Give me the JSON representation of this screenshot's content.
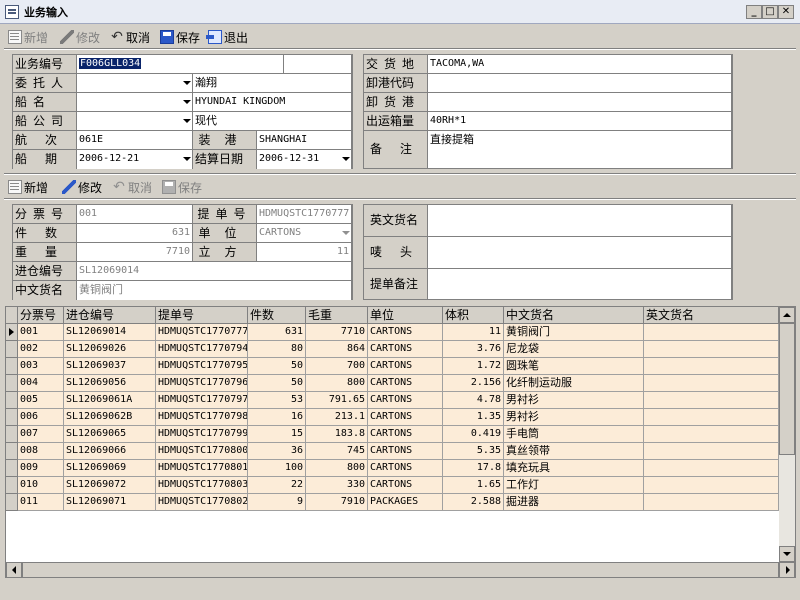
{
  "window": {
    "title": "业务输入"
  },
  "toolbar1": {
    "new": "新增",
    "edit": "修改",
    "cancel": "取消",
    "save": "保存",
    "exit": "退出"
  },
  "toolbar2": {
    "new": "新增",
    "edit": "修改",
    "cancel": "取消",
    "save": "保存"
  },
  "main_form": {
    "business_no_label": "业务编号",
    "business_no": "F006GLL034",
    "client_label": "委托人",
    "client": "",
    "client_name": "瀚翔",
    "ship_name_label": "船名",
    "ship_name": "",
    "ship_name_value": "HYUNDAI KINGDOM",
    "ship_company_label": "船公司",
    "ship_company": "",
    "ship_company_name": "现代",
    "voyage_label": "航次",
    "voyage": "061E",
    "load_port_label": "装港",
    "load_port": "SHANGHAI",
    "ship_date_label": "船期",
    "ship_date": "2006-12-21",
    "settle_date_label": "结算日期",
    "settle_date": "2006-12-31",
    "delivery_place_label": "交货地",
    "delivery_place": "TACOMA,WA",
    "unload_code_label": "卸港代码",
    "unload_code": "",
    "unload_port_label": "卸货港",
    "unload_port": "",
    "container_label": "出运箱量",
    "container": "40RH*1",
    "remark_label": "备注",
    "remark": "直接提箱"
  },
  "detail_form": {
    "split_no_label": "分票号",
    "split_no": "001",
    "bl_no_label": "提单号",
    "bl_no": "HDMUQSTC1770777",
    "pieces_label": "件数",
    "pieces": "631",
    "unit_label": "单位",
    "unit": "CARTONS",
    "weight_label": "重量",
    "weight": "7710",
    "volume_label": "立方",
    "volume": "11",
    "warehouse_no_label": "进仓编号",
    "warehouse_no": "SL12069014",
    "cn_goods_label": "中文货名",
    "cn_goods": "黄铜阀门",
    "en_goods_label": "英文货名",
    "en_goods": "",
    "mark_label": "唛头",
    "mark": "",
    "bl_remark_label": "提单备注",
    "bl_remark": ""
  },
  "grid": {
    "columns": [
      "分票号",
      "进仓编号",
      "提单号",
      "件数",
      "毛重",
      "单位",
      "体积",
      "中文货名",
      "英文货名"
    ],
    "rows": [
      [
        "001",
        "SL12069014",
        "HDMUQSTC1770777",
        "631",
        "7710",
        "CARTONS",
        "11",
        "黄铜阀门",
        ""
      ],
      [
        "002",
        "SL12069026",
        "HDMUQSTC1770794",
        "80",
        "864",
        "CARTONS",
        "3.76",
        "尼龙袋",
        ""
      ],
      [
        "003",
        "SL12069037",
        "HDMUQSTC1770795",
        "50",
        "700",
        "CARTONS",
        "1.72",
        "圆珠笔",
        ""
      ],
      [
        "004",
        "SL12069056",
        "HDMUQSTC1770796",
        "50",
        "800",
        "CARTONS",
        "2.156",
        "化纤制运动服",
        ""
      ],
      [
        "005",
        "SL12069061A",
        "HDMUQSTC1770797",
        "53",
        "791.65",
        "CARTONS",
        "4.78",
        "男衬衫",
        ""
      ],
      [
        "006",
        "SL12069062B",
        "HDMUQSTC1770798",
        "16",
        "213.1",
        "CARTONS",
        "1.35",
        "男衬衫",
        ""
      ],
      [
        "007",
        "SL12069065",
        "HDMUQSTC1770799",
        "15",
        "183.8",
        "CARTONS",
        "0.419",
        "手电筒",
        ""
      ],
      [
        "008",
        "SL12069066",
        "HDMUQSTC1770800",
        "36",
        "745",
        "CARTONS",
        "5.35",
        "真丝领带",
        ""
      ],
      [
        "009",
        "SL12069069",
        "HDMUQSTC1770801",
        "100",
        "800",
        "CARTONS",
        "17.8",
        "填充玩具",
        ""
      ],
      [
        "010",
        "SL12069072",
        "HDMUQSTC1770803",
        "22",
        "330",
        "CARTONS",
        "1.65",
        "工作灯",
        ""
      ],
      [
        "011",
        "SL12069071",
        "HDMUQSTC1770802",
        "9",
        "7910",
        "PACKAGES",
        "2.588",
        "掘进器",
        ""
      ]
    ]
  }
}
